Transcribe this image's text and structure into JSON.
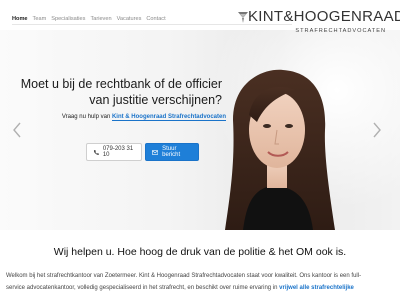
{
  "nav": {
    "items": [
      {
        "label": "Home",
        "active": true
      },
      {
        "label": "Team",
        "active": false
      },
      {
        "label": "Specialisaties",
        "active": false
      },
      {
        "label": "Tarieven",
        "active": false
      },
      {
        "label": "Vacatures",
        "active": false
      },
      {
        "label": "Contact",
        "active": false
      }
    ]
  },
  "logo": {
    "name": "KINT&HOOGENRAAD",
    "subtitle": "STRAFRECHTADVOCATEN"
  },
  "hero": {
    "headline_line1": "Moet u bij de rechtbank of de officier",
    "headline_line2": "van justitie verschijnen?",
    "sub_prefix": "Vraag nu hulp van",
    "sub_brand": "Kint & Hoogenraad Strafrechtadvocaten",
    "phone_label": "079-203 31 10",
    "message_label": "Stuur bericht",
    "phone_icon": "phone-icon",
    "message_icon": "message-icon"
  },
  "content": {
    "tagline": "Wij helpen u. Hoe hoog de druk van de politie & het OM ook is.",
    "paragraph_line1": "Welkom bij het strafrechtkantoor van Zoetermeer. Kint & Hoogenraad Strafrechtadvocaten staat voor kwaliteit. Ons kantoor is een full-",
    "paragraph_line2": "service advocatenkantoor, volledig gespecialiseerd in het strafrecht, en beschikt over ruime ervaring in",
    "paragraph_link": "vrijwel alle strafrechtelijke"
  },
  "colors": {
    "accent": "#1e7fd8",
    "brand_link": "#1a73c9"
  }
}
